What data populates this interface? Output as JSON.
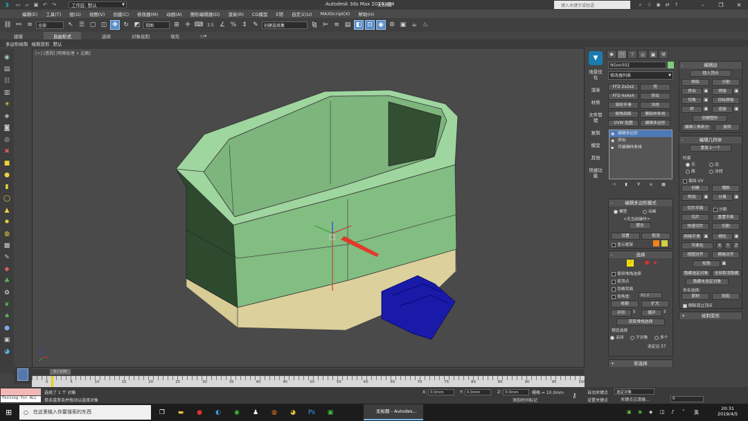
{
  "titlebar": {
    "workspace": "工作区: 默认",
    "app_title": "Autodesk 3ds Max  2014 x64",
    "doc_title": "无标题",
    "search_placeholder": "键入关键字或短语"
  },
  "menu": [
    "编辑(E)",
    "工具(T)",
    "组(G)",
    "视图(V)",
    "创建(C)",
    "修改器(M)",
    "动画(A)",
    "图形编辑器(D)",
    "渲染(R)",
    "CG模型",
    "E馆",
    "自定义(U)",
    "MAXScript(X)",
    "帮助(H)"
  ],
  "toolbar": {
    "filter": "全部",
    "refsys": "视图",
    "snap": "2.5",
    "named_sel": "创建选择集"
  },
  "ribbon": {
    "tabs": [
      "建模",
      "自由形式",
      "选择",
      "对象绘制",
      "填充"
    ],
    "active": "自由形式",
    "sub": [
      "多边形绘制",
      "绘制变形",
      "默认"
    ]
  },
  "viewport": {
    "label": "[+] [透视] [明暗处理 + 边面]"
  },
  "timeline": {
    "slider": "0 / 100",
    "ticks": [
      "0",
      "5",
      "10",
      "15",
      "20",
      "25",
      "30",
      "35",
      "40",
      "45",
      "50",
      "55",
      "60",
      "65",
      "70",
      "75",
      "80",
      "85",
      "90",
      "95",
      "100"
    ]
  },
  "status": {
    "maxscript": "Testing for ALL",
    "line1": "选择了 1 个 对象",
    "line2": "单击或单击并拖动以选择对象",
    "x_label": "X:",
    "x": "0.0mm",
    "y_label": "Y:",
    "y": "0.0mm",
    "z_label": "Z:",
    "z": "0.0mm",
    "grid": "栅格 = 10.0mm",
    "add_time": "添加时间标记",
    "auto_key": "自动关键点",
    "set_key": "设置关键点",
    "sel_set": "选定对象",
    "key_filter": "关键点过滤器...",
    "frame": "0"
  },
  "side_tabs": [
    "场景优化",
    "渲染",
    "材质",
    "文件管理",
    "复制",
    "模型",
    "其他",
    "快捷功能"
  ],
  "cmd": {
    "obj_name": "NGon002",
    "mod_list": "修改器列表",
    "mod_buttons": [
      "FFD 2x2x2",
      "壳",
      "FFD 4x4x4",
      "挤出",
      "涡轮平滑",
      "法线",
      "倒角剖面",
      "删除样条线",
      "UVW 贴图",
      "编辑多边形"
    ],
    "stack": [
      "编辑多边形",
      "挤出",
      "可编辑样条线"
    ],
    "mode_title": "编辑多边形模式",
    "mode_model": "模型",
    "mode_anim": "动画",
    "no_op": "<无当前操作>",
    "commit": "提交",
    "settings": "设置",
    "cancel": "取消",
    "show_cage": "显示框架",
    "sel_title": "选择",
    "by_vertex": "使用堆栈选择",
    "by_vertex2": "按顶点",
    "ignore_back": "忽略背面",
    "by_angle": "按角度:",
    "angle": "45.0",
    "shrink": "收缩",
    "grow": "扩大",
    "ring": "环形",
    "loop": "循环",
    "get_stack": "获取堆栈选择",
    "preview_sel": "预览选择",
    "off": "关闭",
    "subobj": "子对象",
    "multi": "多个",
    "sel_count": "选定边 57",
    "soft_sel": "软选择"
  },
  "edit_edges": {
    "title": "编辑边",
    "insert_vertex": "插入顶点",
    "buttons": [
      "移除",
      "分割",
      "挤出",
      "焊接",
      "切角",
      "目标焊接",
      "桥",
      "连接"
    ],
    "create_shape": "创建图形",
    "edit_tri": "编辑三角剖分",
    "turn": "旋转"
  },
  "edit_geom": {
    "title": "编辑几何体",
    "repeat": "重复上一个",
    "constraints": "约束",
    "c_none": "无",
    "c_edge": "边",
    "c_face": "面",
    "c_normal": "法线",
    "keep_uv": "保持 UV",
    "create": "创建",
    "collapse": "塌陷",
    "attach": "附加",
    "detach": "分离",
    "slice_plane": "切片平面",
    "split": "分割",
    "slice": "切片",
    "reset_plane": "重置平面",
    "quickslice": "快速切片",
    "cut": "切割",
    "meshsmooth": "网格平滑",
    "tessellate": "细化",
    "planarize": "平面化",
    "x": "X",
    "y": "Y",
    "z": "Z",
    "view_align": "视图对齐",
    "grid_align": "栅格对齐",
    "relax": "松弛",
    "hide_sel": "隐藏选定对象",
    "unhide_all": "全部取消隐藏",
    "hide_unsel": "隐藏未选定对象",
    "named_sel": "命名选择:",
    "copy": "复制",
    "paste": "粘贴",
    "del_iso": "删除孤立顶点"
  },
  "paint_deform": "绘制变形",
  "taskbar": {
    "search": "在这里输入你要搜索的东西",
    "active_app": "无标题 - Autodes...",
    "lang": "英",
    "time": "20:31",
    "date": "2019/4/5"
  },
  "colors": {
    "box_green": "#7fb57f",
    "base_tan": "#e0d6a6",
    "steps_blue": "#1a1aa8",
    "accent": "#5a8dc8"
  }
}
